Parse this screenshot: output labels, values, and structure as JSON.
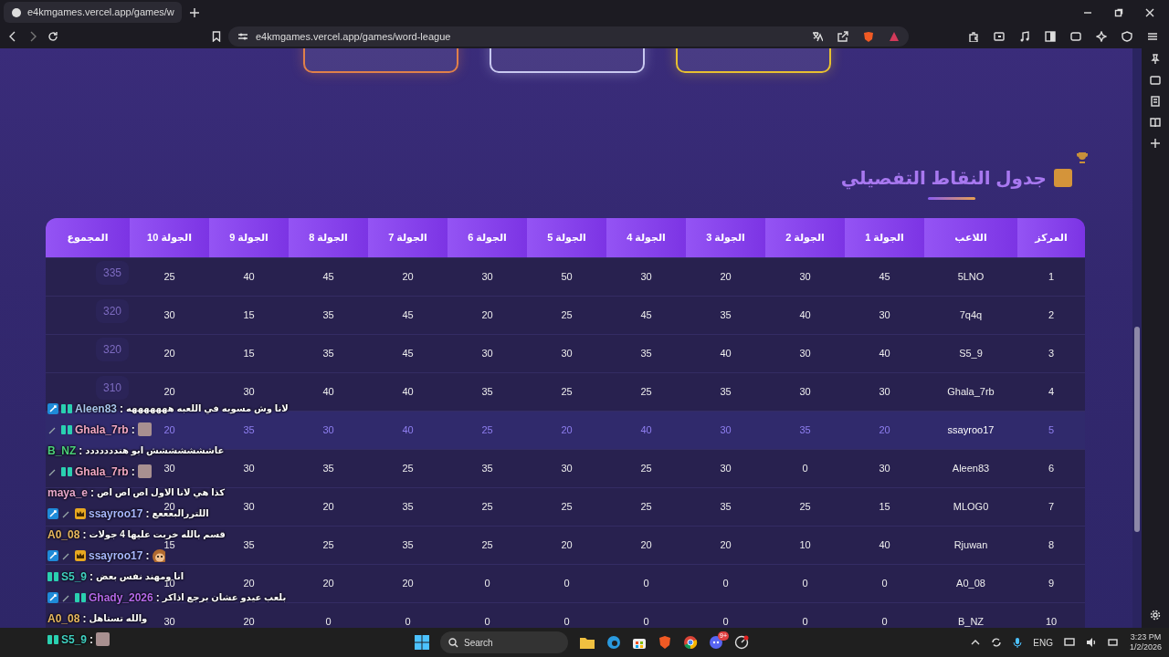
{
  "browser": {
    "tab_title": "e4kmgames.vercel.app/games/w",
    "url": "e4kmgames.vercel.app/games/word-league"
  },
  "page": {
    "cards": [
      {
        "color": "#e0804a"
      },
      {
        "color": "#c8c8f0"
      },
      {
        "color": "#e8c030"
      }
    ],
    "section_title": "جدول النقاط التفصيلي",
    "table": {
      "columns": [
        "المركز",
        "اللاعب",
        "الجولة 1",
        "الجولة 2",
        "الجولة 3",
        "الجولة 4",
        "الجولة 5",
        "الجولة 6",
        "الجولة 7",
        "الجولة 8",
        "الجولة 9",
        "الجولة 10",
        "المجموع"
      ],
      "rows": [
        {
          "rank": "1",
          "player": "5LNO",
          "rounds": [
            "45",
            "30",
            "20",
            "30",
            "50",
            "30",
            "20",
            "45",
            "40",
            "25"
          ],
          "total": "335",
          "highlighted": false
        },
        {
          "rank": "2",
          "player": "7q4q",
          "rounds": [
            "30",
            "40",
            "35",
            "45",
            "25",
            "20",
            "45",
            "35",
            "15",
            "30"
          ],
          "total": "320",
          "highlighted": false
        },
        {
          "rank": "3",
          "player": "S5_9",
          "rounds": [
            "40",
            "30",
            "40",
            "35",
            "30",
            "30",
            "45",
            "35",
            "15",
            "20"
          ],
          "total": "320",
          "highlighted": false
        },
        {
          "rank": "4",
          "player": "Ghala_7rb",
          "rounds": [
            "30",
            "30",
            "35",
            "25",
            "25",
            "35",
            "40",
            "40",
            "30",
            "20"
          ],
          "total": "310",
          "highlighted": false
        },
        {
          "rank": "5",
          "player": "ssayroo17",
          "rounds": [
            "20",
            "35",
            "30",
            "40",
            "20",
            "25",
            "40",
            "30",
            "35",
            "20"
          ],
          "highlighted": true
        },
        {
          "rank": "6",
          "player": "Aleen83",
          "rounds": [
            "30",
            "0",
            "30",
            "25",
            "30",
            "35",
            "25",
            "35",
            "30",
            "30"
          ],
          "highlighted": false
        },
        {
          "rank": "7",
          "player": "MLOG0",
          "rounds": [
            "15",
            "25",
            "35",
            "25",
            "25",
            "25",
            "35",
            "20",
            "30",
            "20"
          ],
          "highlighted": false
        },
        {
          "rank": "8",
          "player": "Rjuwan",
          "rounds": [
            "40",
            "10",
            "20",
            "20",
            "20",
            "25",
            "35",
            "25",
            "35",
            "15"
          ],
          "highlighted": false
        },
        {
          "rank": "9",
          "player": "A0_08",
          "rounds": [
            "0",
            "0",
            "0",
            "0",
            "0",
            "0",
            "20",
            "20",
            "20",
            "10"
          ],
          "highlighted": false
        },
        {
          "rank": "10",
          "player": "B_NZ",
          "rounds": [
            "0",
            "0",
            "0",
            "0",
            "0",
            "0",
            "0",
            "0",
            "20",
            "30"
          ],
          "highlighted": false
        }
      ]
    }
  },
  "chat": [
    {
      "badges": [
        {
          "kind": "mod"
        },
        {
          "kind": "sub"
        }
      ],
      "name": "Aleen83",
      "separator": ":",
      "color": "#a8c4ec",
      "kind": "text",
      "message": "لانا وش مسويه في اللعبه هههههههه"
    },
    {
      "badges": [
        {
          "kind": "tool"
        },
        {
          "kind": "sub"
        }
      ],
      "name": "Ghala_7rb",
      "separator": ":",
      "color": "#f2a8c4",
      "kind": "image"
    },
    {
      "name": "B_NZ",
      "separator": ":",
      "color": "#4ccf7a",
      "kind": "text",
      "message": "عاششششششش ابو هنددددددد"
    },
    {
      "badges": [
        {
          "kind": "tool"
        },
        {
          "kind": "sub"
        }
      ],
      "name": "Ghala_7rb",
      "separator": ":",
      "color": "#f2a8c4",
      "kind": "image"
    },
    {
      "name": "maya_e",
      "separator": ":",
      "color": "#e8a8cc",
      "kind": "text",
      "message": "كذا هي لانا الاول اص اص اص"
    },
    {
      "badges": [
        {
          "kind": "mod"
        },
        {
          "kind": "tool"
        },
        {
          "kind": "crown"
        }
      ],
      "name": "ssayroo17",
      "separator": ":",
      "color": "#a8b8ff",
      "kind": "text",
      "message": "اللتررالبعععع"
    },
    {
      "name": "A0_08",
      "separator": ":",
      "color": "#e8b860",
      "kind": "text",
      "message": "قسم بالله خربت عليها 4 جولات"
    },
    {
      "badges": [
        {
          "kind": "mod"
        },
        {
          "kind": "tool"
        },
        {
          "kind": "crown"
        }
      ],
      "name": "ssayroo17",
      "separator": ":",
      "color": "#a8b8ff",
      "kind": "emoji"
    },
    {
      "badges": [
        {
          "kind": "sub"
        }
      ],
      "name": "S5_9",
      "separator": ":",
      "color": "#40d0c0",
      "kind": "text",
      "message": "انا ومهند نفس بعض"
    },
    {
      "badges": [
        {
          "kind": "mod"
        },
        {
          "kind": "tool"
        },
        {
          "kind": "sub"
        }
      ],
      "name": "Ghady_2026",
      "separator": ":",
      "color": "#b468e8",
      "kind": "text",
      "message": "بلعب عيدو عشان برجع اذاكر"
    },
    {
      "name": "A0_08",
      "separator": ":",
      "color": "#e8b860",
      "kind": "text",
      "message": "والله تستاهل"
    },
    {
      "badges": [
        {
          "kind": "sub"
        }
      ],
      "name": "S5_9",
      "separator": ":",
      "color": "#40d0c0",
      "kind": "image"
    }
  ],
  "taskbar": {
    "search": {
      "placeholder": "Search"
    },
    "discord_badge": "9+",
    "language": "ENG",
    "time": "3:23 PM",
    "date": "1/2/2026"
  }
}
